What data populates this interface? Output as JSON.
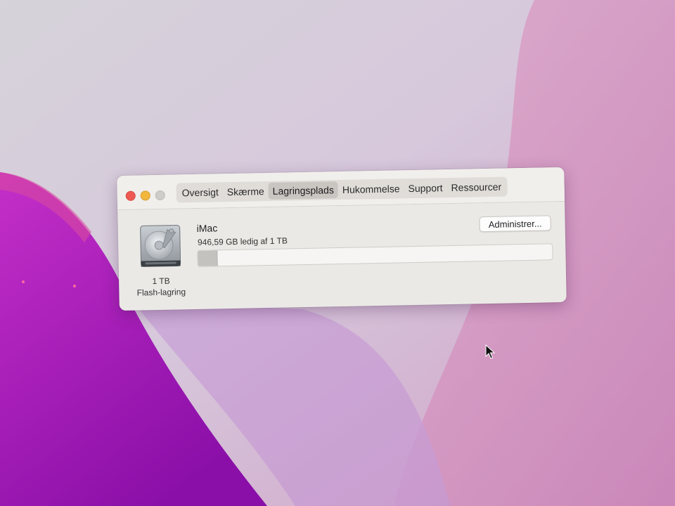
{
  "window": {
    "tabs": [
      {
        "label": "Oversigt",
        "active": false
      },
      {
        "label": "Skærme",
        "active": false
      },
      {
        "label": "Lagringsplads",
        "active": true
      },
      {
        "label": "Hukommelse",
        "active": false
      },
      {
        "label": "Support",
        "active": false
      },
      {
        "label": "Ressourcer",
        "active": false
      }
    ]
  },
  "disk": {
    "icon": "hard-drive-icon",
    "size_label": "1 TB",
    "type_label": "Flash-lagring"
  },
  "drive": {
    "name": "iMac",
    "free_text": "946,59 GB ledig af 1 TB",
    "used_fraction": 0.053
  },
  "actions": {
    "manage_label": "Administrer..."
  },
  "colors": {
    "traffic_close": "#ee5a52",
    "traffic_minimize": "#f2b73d",
    "traffic_zoom_inactive": "#cfcdca",
    "wallpaper_magenta": "#b52bc4"
  }
}
